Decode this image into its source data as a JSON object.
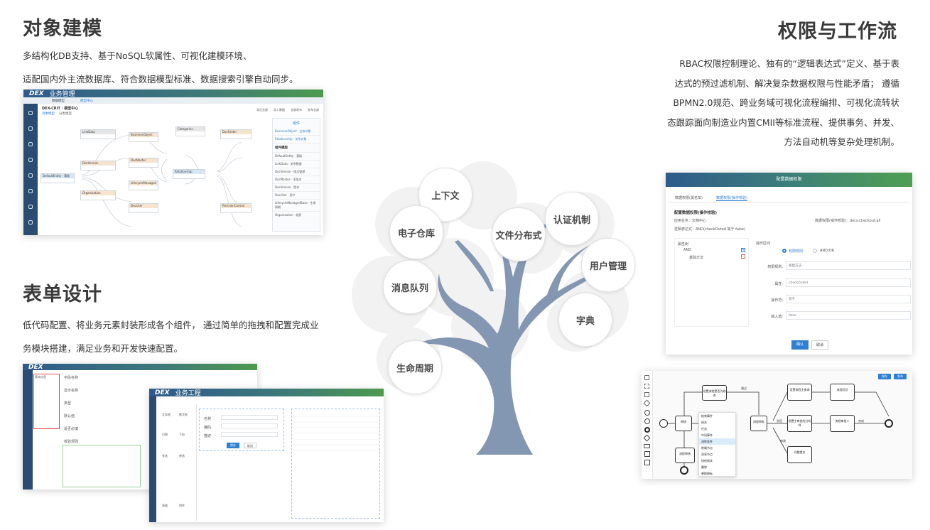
{
  "modeling": {
    "title": "对象建模",
    "lines": [
      "多结构化DB支持、基于NoSQL软属性、可视化建模环境、",
      "适配国内外主流数据库、符合数据模型标准、数据搜索引擎自动同步。"
    ],
    "shot": {
      "brand": "DEX",
      "app": "业务管理",
      "tabs": [
        "数据模型",
        "模型中心"
      ],
      "header": "DEX-CRIT · 模型中心",
      "subtabs": [
        "对象模型",
        "分类模型"
      ],
      "panel_title": "组件",
      "panel_items": [
        "BusinessObject · 业务对象",
        "Relationship · 关系对象"
      ],
      "panel_subtitle": "组件模版",
      "panel_list": [
        "DefaultEntity · 基础",
        "LinkData · 关系数据",
        "DocVersion · 版本管理",
        "DocMaster · 主版本",
        "DocVersion · 版本",
        "DocUser · 用户",
        "LifecycleManagedBase · 生命周期",
        "Organization · 组织"
      ],
      "toolbar": [
        "导出全部",
        "导入数据",
        "全部发布",
        "发布全部"
      ],
      "nodes": [
        "DefaultEntity · 基础",
        "LinkData",
        "DocVersion",
        "Organization",
        "BusinessObject",
        "DocMaster",
        "LifecycleManaged",
        "DocUser",
        "Relationship",
        "Categories",
        "DocFolder",
        "RevisionControl"
      ]
    }
  },
  "forms": {
    "title": "表单设计",
    "lines": [
      "低代码配置、将业务元素封装形成各个组件， 通过简单的拖拽和配置完成业",
      "务模块搭建，满足业务和开发快速配置。"
    ],
    "shot": {
      "brand": "DEX",
      "app": "业务工程",
      "left_labels": [
        "基本信息",
        "字段名称",
        "显示名称",
        "类型",
        "默认值",
        "是否必填",
        "校验规则"
      ],
      "right_labels": [
        "名称",
        "编码",
        "描述"
      ],
      "button_ok": "保存",
      "button_cancel": "取消",
      "widgets": [
        "文本框",
        "数字框",
        "日期",
        "下拉",
        "多选",
        "单选",
        "表格",
        "附件"
      ]
    }
  },
  "workflow": {
    "title": "权限与工作流",
    "lines": [
      "RBAC权限控制理论、独有的“逻辑表达式”定义、基于表",
      "达式的预过滤机制、解决复杂数据权限与性能矛盾； 遵循",
      "BPMN2.0规范、跨业务域可视化流程编排、可视化流转状",
      "态跟踪面向制造业内置CMII等标准流程、提供事务、并发、",
      "方法自动机等复杂处理机制。"
    ],
    "dialog": {
      "title": "配置数据权限",
      "tabs": [
        "数据权限(黑名单)",
        "数据权限(操作校验)"
      ],
      "section": "配置数据权限(操作校验)",
      "app_label": "应用业务：文档中心",
      "perm_label": "数据权限(操作校验)：docs:checkout:all",
      "expr_label": "逻辑表达式：AND(checkOuted 等于 false)",
      "tree_title": "属性树",
      "tree_items": [
        "AND",
        "基础方法"
      ],
      "op_title": "操作区间",
      "radio_a": "权限规则",
      "radio_b": "AND/OR",
      "rows": [
        {
          "label": "权限规则:",
          "value": "基础方法"
        },
        {
          "label": "属性:",
          "value": "checkOuted"
        },
        {
          "label": "操作符:",
          "value": "等于"
        },
        {
          "label": "输入值:",
          "value": "false"
        }
      ],
      "ok": "确认",
      "cancel": "取消"
    },
    "bpmn": {
      "buttons": [
        "保存",
        "发布"
      ],
      "tasks": [
        "审核",
        "设置流程是否为修改",
        "设置流程主查询",
        "流程审批",
        "设置主审批的分析师",
        "流程验证",
        "流程审核",
        "流程审批人",
        "问题提交"
      ],
      "menu": [
        "结束事件",
        "网关",
        "任务",
        "中间事件",
        "流转条件",
        "附属节点",
        "消息节点",
        "排他网关",
        "删除",
        "更换图标"
      ],
      "edge_labels": [
        "通过",
        "驳回",
        "修改",
        "完成"
      ]
    }
  },
  "tree": {
    "bubbles": [
      "上下文",
      "电子仓库",
      "文件分布式",
      "认证机制",
      "用户管理",
      "消息队列",
      "字典",
      "生命周期"
    ],
    "trunk_color": "#8396b2"
  },
  "colors": {
    "heading": "#3a3a3a",
    "accent_blue": "#2f7fd4",
    "sidebar": "#2a4c72"
  }
}
